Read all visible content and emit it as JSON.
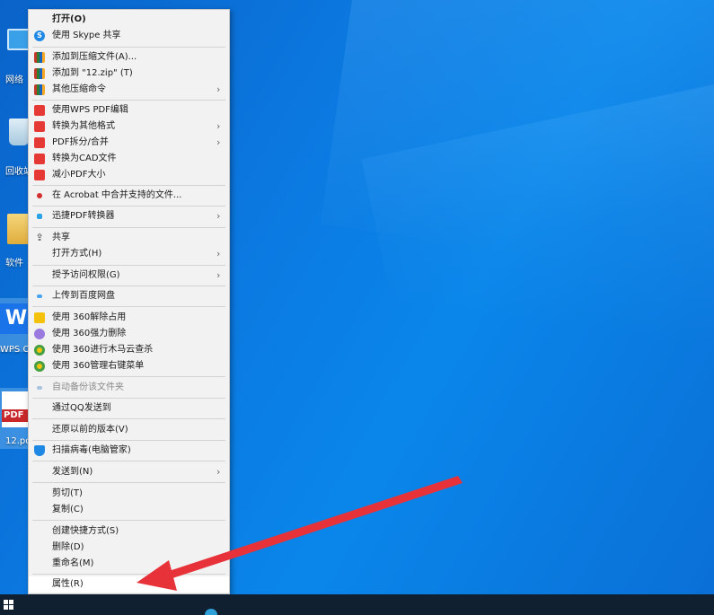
{
  "desktop": {
    "icons": [
      {
        "name": "network",
        "label": "网络"
      },
      {
        "name": "recycle-bin",
        "label": "回收站"
      },
      {
        "name": "software-folder",
        "label": "软件"
      },
      {
        "name": "wps-office",
        "label": "WPS O",
        "glyph": "W"
      },
      {
        "name": "pdf-file",
        "label": "12.pd",
        "badge": "PDF"
      }
    ]
  },
  "menu": {
    "items": [
      {
        "label": "打开(O)",
        "icon": "none",
        "bold": true
      },
      {
        "label": "使用 Skype 共享",
        "icon": "skype-icon"
      },
      {
        "label": "添加到压缩文件(A)...",
        "icon": "winrar-icon"
      },
      {
        "label": "添加到 \"12.zip\" (T)",
        "icon": "winrar-icon"
      },
      {
        "label": "其他压缩命令",
        "icon": "winrar-icon",
        "submenu": true
      },
      {
        "label": "使用WPS PDF编辑",
        "icon": "wps-pdf-icon"
      },
      {
        "label": "转换为其他格式",
        "icon": "wps-pdf-icon",
        "submenu": true
      },
      {
        "label": "PDF拆分/合并",
        "icon": "wps-pdf-icon",
        "submenu": true
      },
      {
        "label": "转换为CAD文件",
        "icon": "wps-pdf-icon"
      },
      {
        "label": "减小PDF大小",
        "icon": "wps-pdf-icon"
      },
      {
        "label": "在 Acrobat 中合并支持的文件...",
        "icon": "acrobat-icon"
      },
      {
        "label": "迅捷PDF转换器",
        "icon": "xunjie-icon",
        "submenu": true
      },
      {
        "label": "共享",
        "icon": "share-icon"
      },
      {
        "label": "打开方式(H)",
        "icon": "none",
        "submenu": true
      },
      {
        "label": "授予访问权限(G)",
        "icon": "none",
        "submenu": true
      },
      {
        "label": "上传到百度网盘",
        "icon": "baidu-netdisk-icon"
      },
      {
        "label": "使用 360解除占用",
        "icon": "360-unlock-icon"
      },
      {
        "label": "使用 360强力删除",
        "icon": "360-delete-icon"
      },
      {
        "label": "使用 360进行木马云查杀",
        "icon": "360-scan-icon"
      },
      {
        "label": "使用 360管理右键菜单",
        "icon": "360-manage-icon"
      },
      {
        "label": "自动备份该文件夹",
        "icon": "cloud-backup-icon",
        "disabled": true
      },
      {
        "label": "通过QQ发送到",
        "icon": "none"
      },
      {
        "label": "还原以前的版本(V)",
        "icon": "none"
      },
      {
        "label": "扫描病毒(电脑管家)",
        "icon": "shield-icon"
      },
      {
        "label": "发送到(N)",
        "icon": "none",
        "submenu": true
      },
      {
        "label": "剪切(T)",
        "icon": "none"
      },
      {
        "label": "复制(C)",
        "icon": "none"
      },
      {
        "label": "创建快捷方式(S)",
        "icon": "none"
      },
      {
        "label": "删除(D)",
        "icon": "none"
      },
      {
        "label": "重命名(M)",
        "icon": "none"
      },
      {
        "label": "属性(R)",
        "icon": "none",
        "highlighted": true
      }
    ],
    "submenu_glyph": "›"
  },
  "annotation": {
    "type": "red-arrow",
    "points_to": "属性(R)",
    "color": "#e8323a"
  },
  "taskbar": {
    "start_icon": "windows-logo-icon"
  }
}
